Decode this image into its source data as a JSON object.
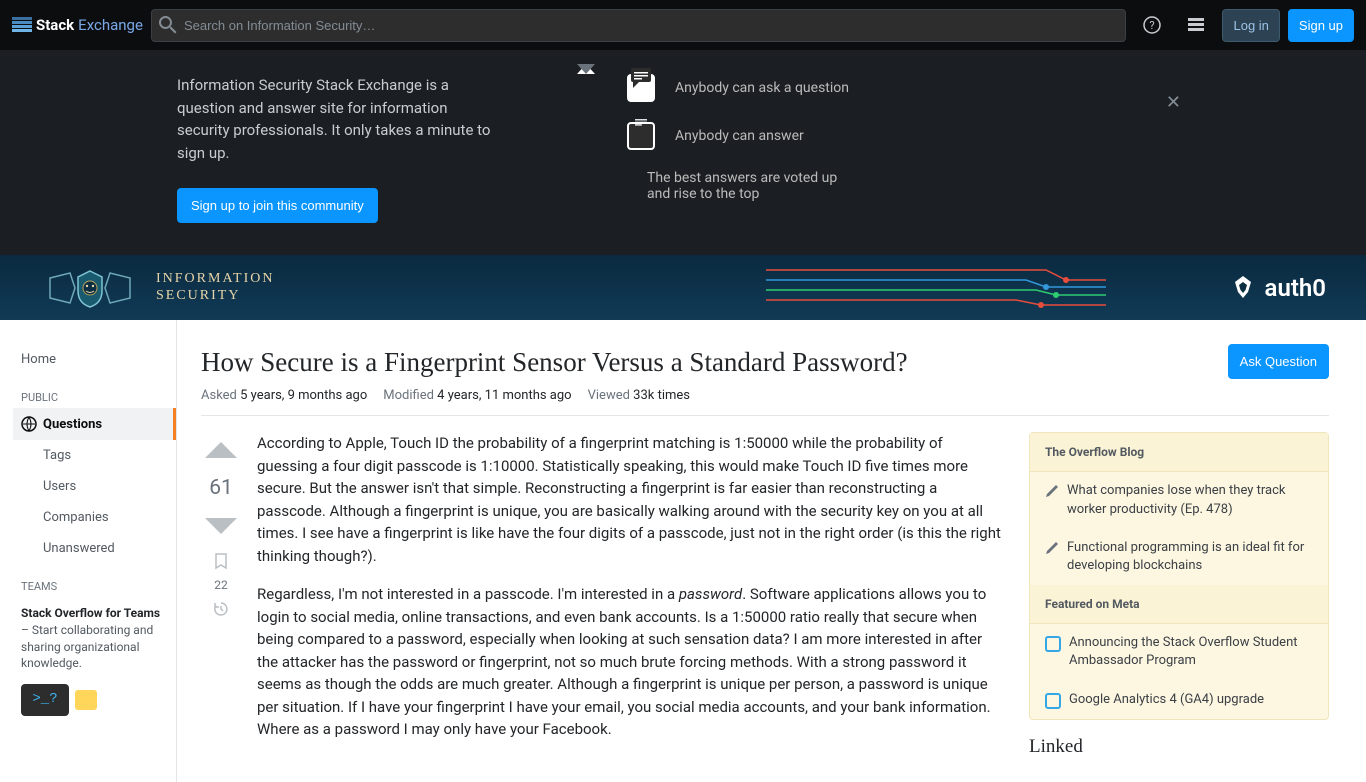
{
  "topbar": {
    "logo_bold": "Stack",
    "logo_light": "Exchange",
    "search_placeholder": "Search on Information Security…",
    "login": "Log in",
    "signup": "Sign up"
  },
  "hero": {
    "description": "Information Security Stack Exchange is a question and answer site for information security professionals. It only takes a minute to sign up.",
    "signup_button": "Sign up to join this community",
    "item1": "Anybody can ask a question",
    "item2": "Anybody can answer",
    "item3": "The best answers are voted up and rise to the top"
  },
  "site": {
    "name_line1": "INFORMATION",
    "name_line2": "SECURITY",
    "sponsor": "auth0"
  },
  "sidebar": {
    "home": "Home",
    "public_label": "PUBLIC",
    "questions": "Questions",
    "tags": "Tags",
    "users": "Users",
    "companies": "Companies",
    "unanswered": "Unanswered",
    "teams_label": "TEAMS",
    "teams_bold": "Stack Overflow for Teams",
    "teams_desc": " – Start collaborating and sharing organizational knowledge.",
    "terminal_text": ">_?"
  },
  "question": {
    "title": "How Secure is a Fingerprint Sensor Versus a Standard Password?",
    "ask_button": "Ask Question",
    "asked_label": "Asked",
    "asked_value": "5 years, 9 months ago",
    "modified_label": "Modified",
    "modified_value": "4 years, 11 months ago",
    "viewed_label": "Viewed",
    "viewed_value": "33k times",
    "score": "61",
    "bookmark_count": "22",
    "body_p1": "According to Apple, Touch ID the probability of a fingerprint matching is 1:50000 while the probability of guessing a four digit passcode is 1:10000. Statistically speaking, this would make Touch ID five times more secure. But the answer isn't that simple. Reconstructing a fingerprint is far easier than reconstructing a passcode. Although a fingerprint is unique, you are basically walking around with the security key on you at all times. I see have a fingerprint is like have the four digits of a passcode, just not in the right order (is this the right thinking though?).",
    "body_p2a": "Regardless, I'm not interested in a passcode. I'm interested in a ",
    "body_p2_em": "password",
    "body_p2b": ". Software applications allows you to login to social media, online transactions, and even bank accounts. Is a 1:50000 ratio really that secure when being compared to a password, especially when looking at such sensation data? I am more interested in after the attacker has the password or fingerprint, not so much brute forcing methods. With a strong password it seems as though the odds are much greater. Although a fingerprint is unique per person, a password is unique per situation. If I have your fingerprint I have your email, you social media accounts, and your bank information. Where as a password I may only have your Facebook."
  },
  "widgets": {
    "blog_header": "The Overflow Blog",
    "blog1": "What companies lose when they track worker productivity (Ep. 478)",
    "blog2": "Functional programming is an ideal fit for developing blockchains",
    "meta_header": "Featured on Meta",
    "meta1": "Announcing the Stack Overflow Student Ambassador Program",
    "meta2": "Google Analytics 4 (GA4) upgrade",
    "linked": "Linked"
  }
}
